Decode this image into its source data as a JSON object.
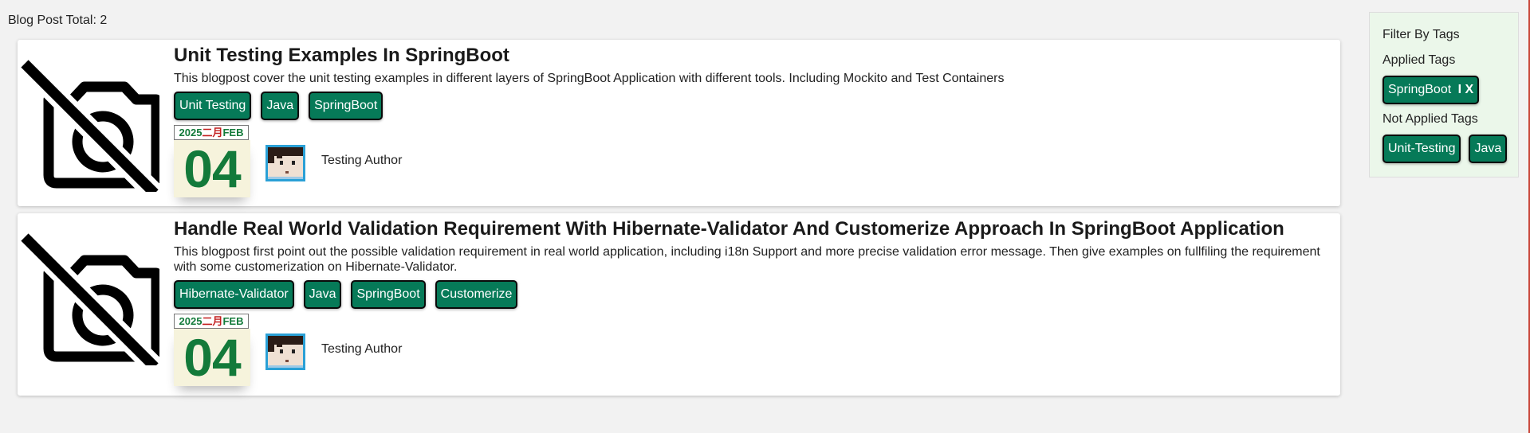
{
  "header": {
    "total": "Blog Post Total: 2"
  },
  "colors": {
    "tag_bg": "#067a58",
    "date_green": "#137a3a",
    "date_red": "#c21d1d",
    "sidebar_bg": "#ebf7ea"
  },
  "posts": [
    {
      "title": "Unit Testing Examples In SpringBoot",
      "description": "This blogpost cover the unit testing examples in different layers of SpringBoot Application with different tools. Including Mockito and Test Containers",
      "tags": [
        "Unit Testing",
        "Java",
        "SpringBoot"
      ],
      "date": {
        "year": "2025",
        "month_cn": "二月",
        "month_en": "FEB",
        "day": "04"
      },
      "author": "Testing Author",
      "thumbnail_icon": "no-photo-icon"
    },
    {
      "title": "Handle Real World Validation Requirement With Hibernate-Validator And Customerize Approach In SpringBoot Application",
      "description": "This blogpost first point out the possible validation requirement in real world application, including i18n Support and more precise validation error message. Then give examples on fullfiling the requirement with some customerization on Hibernate-Validator.",
      "tags": [
        "Hibernate-Validator",
        "Java",
        "SpringBoot",
        "Customerize"
      ],
      "date": {
        "year": "2025",
        "month_cn": "二月",
        "month_en": "FEB",
        "day": "04"
      },
      "author": "Testing Author",
      "thumbnail_icon": "no-photo-icon"
    }
  ],
  "sidebar": {
    "title": "Filter By Tags",
    "applied_label": "Applied Tags",
    "applied_tags": [
      {
        "label": "SpringBoot",
        "remove": "X"
      }
    ],
    "not_applied_label": "Not Applied Tags",
    "not_applied_tags": [
      "Unit-Testing",
      "Java"
    ]
  }
}
